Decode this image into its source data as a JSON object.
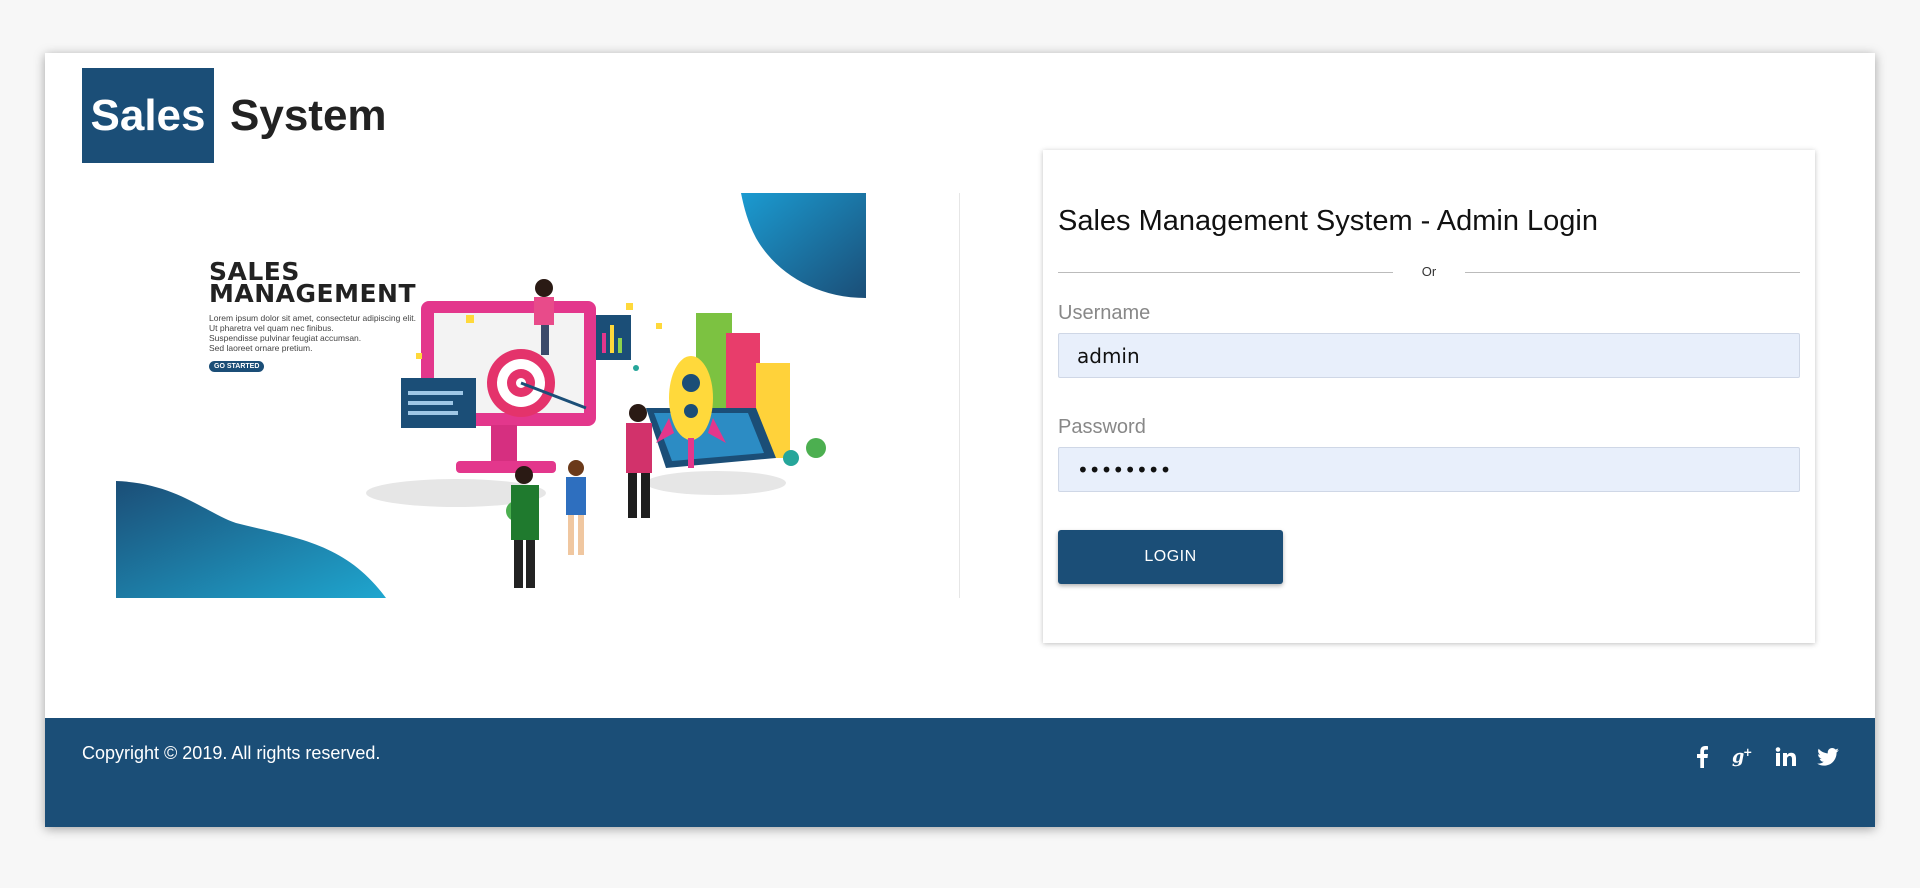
{
  "brand": {
    "logo_box_text": "Sales",
    "logo_text": "System"
  },
  "illustration": {
    "title": "SALES\nMANAGEMENT",
    "lorem": "Lorem ipsum dolor sit amet, consectetur adipiscing elit.\nUt pharetra vel quam nec finibus.\nSuspendisse pulvinar feugiat accumsan.\nSed laoreet ornare pretium.",
    "cta": "GO STARTED"
  },
  "login": {
    "title": "Sales Management System - Admin Login",
    "or_text": "Or",
    "username_label": "Username",
    "username_value": "admin",
    "password_label": "Password",
    "password_value": "admin123",
    "button_label": "LOGIN"
  },
  "footer": {
    "copyright": "Copyright © 2019. All rights reserved.",
    "social_icons": [
      "facebook-icon",
      "google-plus-icon",
      "linkedin-icon",
      "twitter-icon"
    ]
  },
  "colors": {
    "brand": "#1b4e77",
    "input_bg": "#e8effb",
    "page_bg": "#f7f7f7"
  }
}
